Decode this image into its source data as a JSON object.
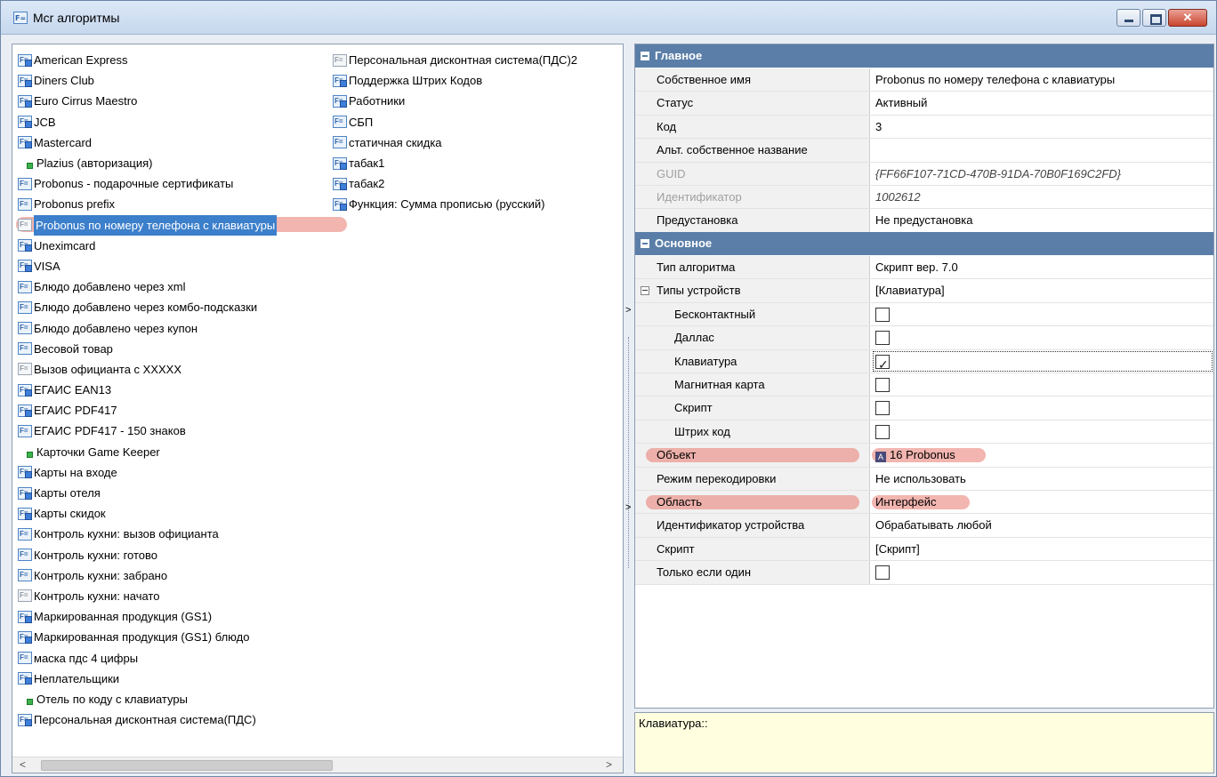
{
  "window": {
    "title": "Mcr алгоритмы"
  },
  "list": {
    "col1": [
      {
        "label": "American Express",
        "icon": "fx-blue"
      },
      {
        "label": "Diners Club",
        "icon": "fx-blue"
      },
      {
        "label": "Euro Cirrus Maestro",
        "icon": "fx-blue"
      },
      {
        "label": "JCB",
        "icon": "fx-blue"
      },
      {
        "label": "Mastercard",
        "icon": "fx-blue"
      },
      {
        "label": "Plazius (авторизация)",
        "icon": "green-dot"
      },
      {
        "label": "Probonus - подарочные сертификаты",
        "icon": "fx"
      },
      {
        "label": "Probonus prefix",
        "icon": "fx"
      },
      {
        "label": "Probonus по номеру телефона с клавиатуры",
        "icon": "fx-gray",
        "selected": true
      },
      {
        "label": "Uneximcard",
        "icon": "fx-blue"
      },
      {
        "label": "VISA",
        "icon": "fx-blue"
      },
      {
        "label": "Блюдо добавлено через xml",
        "icon": "fx"
      },
      {
        "label": "Блюдо добавлено через комбо-подсказки",
        "icon": "fx"
      },
      {
        "label": "Блюдо добавлено через купон",
        "icon": "fx"
      },
      {
        "label": "Весовой товар",
        "icon": "fx"
      },
      {
        "label": "Вызов официанта с XXXXX",
        "icon": "fx-gray"
      },
      {
        "label": "ЕГАИС EAN13",
        "icon": "fx-blue"
      },
      {
        "label": "ЕГАИС PDF417",
        "icon": "fx-blue"
      },
      {
        "label": "ЕГАИС PDF417 - 150 знаков",
        "icon": "fx"
      },
      {
        "label": "Карточки Game Keeper",
        "icon": "green-dot"
      },
      {
        "label": "Карты на входе",
        "icon": "fx-blue"
      },
      {
        "label": "Карты отеля",
        "icon": "fx-blue"
      },
      {
        "label": "Карты скидок",
        "icon": "fx-blue"
      },
      {
        "label": "Контроль кухни: вызов официанта",
        "icon": "fx"
      },
      {
        "label": "Контроль кухни: готово",
        "icon": "fx"
      },
      {
        "label": "Контроль кухни: забрано",
        "icon": "fx"
      },
      {
        "label": "Контроль кухни: начато",
        "icon": "fx-gray"
      },
      {
        "label": "Маркированная продукция (GS1)",
        "icon": "fx-blue"
      },
      {
        "label": "Маркированная продукция (GS1) блюдо",
        "icon": "fx-blue"
      },
      {
        "label": "маска пдс 4 цифры",
        "icon": "fx"
      },
      {
        "label": "Неплательщики",
        "icon": "fx-blue"
      },
      {
        "label": "Отель по коду с клавиатуры",
        "icon": "green-dot"
      },
      {
        "label": "Персональная дисконтная система(ПДС)",
        "icon": "fx-blue"
      }
    ],
    "col2": [
      {
        "label": "Персональная дисконтная система(ПДС)2",
        "icon": "fx-gray"
      },
      {
        "label": "Поддержка Штрих Кодов",
        "icon": "fx-blue"
      },
      {
        "label": "Работники",
        "icon": "fx-blue"
      },
      {
        "label": "СБП",
        "icon": "fx"
      },
      {
        "label": "статичная скидка",
        "icon": "fx"
      },
      {
        "label": "табак1",
        "icon": "fx-blue"
      },
      {
        "label": "табак2",
        "icon": "fx-blue"
      },
      {
        "label": "Функция: Сумма прописью (русский)",
        "icon": "fx-blue"
      }
    ]
  },
  "props": {
    "main_header": "Главное",
    "main": [
      {
        "name": "Собственное имя",
        "value": "Probonus по номеру телефона с клавиатуры"
      },
      {
        "name": "Статус",
        "value": "Активный"
      },
      {
        "name": "Код",
        "value": "3"
      },
      {
        "name": "Альт. собственное название",
        "value": ""
      },
      {
        "name": "GUID",
        "value": "{FF66F107-71CD-470B-91DA-70B0F169C2FD}",
        "disabled": true
      },
      {
        "name": "Идентификатор",
        "value": "1002612",
        "disabled": true
      },
      {
        "name": "Предустановка",
        "value": "Не предустановка"
      }
    ],
    "basic_header": "Основное",
    "algo_type": {
      "name": "Тип алгоритма",
      "value": "Скрипт вер. 7.0"
    },
    "device_types": {
      "name": "Типы устройств",
      "value": "[Клавиатура]"
    },
    "devices": [
      {
        "name": "Бесконтактный",
        "checked": false
      },
      {
        "name": "Даллас",
        "checked": false
      },
      {
        "name": "Клавиатура",
        "checked": true
      },
      {
        "name": "Магнитная карта",
        "checked": false
      },
      {
        "name": "Скрипт",
        "checked": false
      },
      {
        "name": "Штрих код",
        "checked": false
      }
    ],
    "object": {
      "name": "Объект",
      "value": "16 Probonus"
    },
    "recode": {
      "name": "Режим перекодировки",
      "value": "Не использовать"
    },
    "area": {
      "name": "Область",
      "value": "Интерфейс"
    },
    "device_id": {
      "name": "Идентификатор устройства",
      "value": "Обрабатывать любой"
    },
    "script": {
      "name": "Скрипт",
      "value": "[Скрипт]"
    },
    "only_one": {
      "name": "Только если один",
      "checked": false
    }
  },
  "description": "Клавиатура::"
}
